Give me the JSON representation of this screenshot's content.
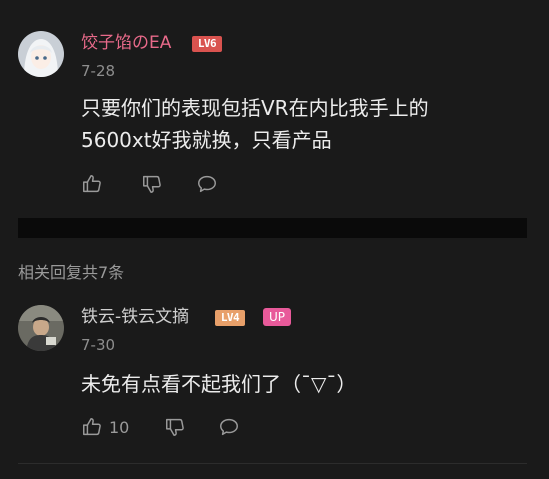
{
  "main_comment": {
    "username": "饺子馅のEA",
    "username_color": "#e86a8a",
    "level_badge": "LV6",
    "level_badge_color": "#d9534f",
    "date": "7-28",
    "content_lines": [
      "只要你们的表现包括VR在内比我手上的",
      "5600xt好我就换，只看产品"
    ],
    "actions": [
      "thumbs-up-icon",
      "thumbs-down-icon",
      "comment-bubble-icon"
    ]
  },
  "replies_header": "相关回复共7条",
  "reply": {
    "username": "铁云-铁云文摘",
    "username_color": "#cfcfcf",
    "level_badge": "LV4",
    "level_badge_color": "#e8a06a",
    "up_badge": "UP",
    "up_badge_color": "#e85a9a",
    "date": "7-30",
    "content": "未免有点看不起我们了（ˉ▽ˉ）",
    "like_count": "10",
    "actions": [
      "thumbs-up-icon",
      "thumbs-down-icon",
      "comment-bubble-icon"
    ]
  }
}
